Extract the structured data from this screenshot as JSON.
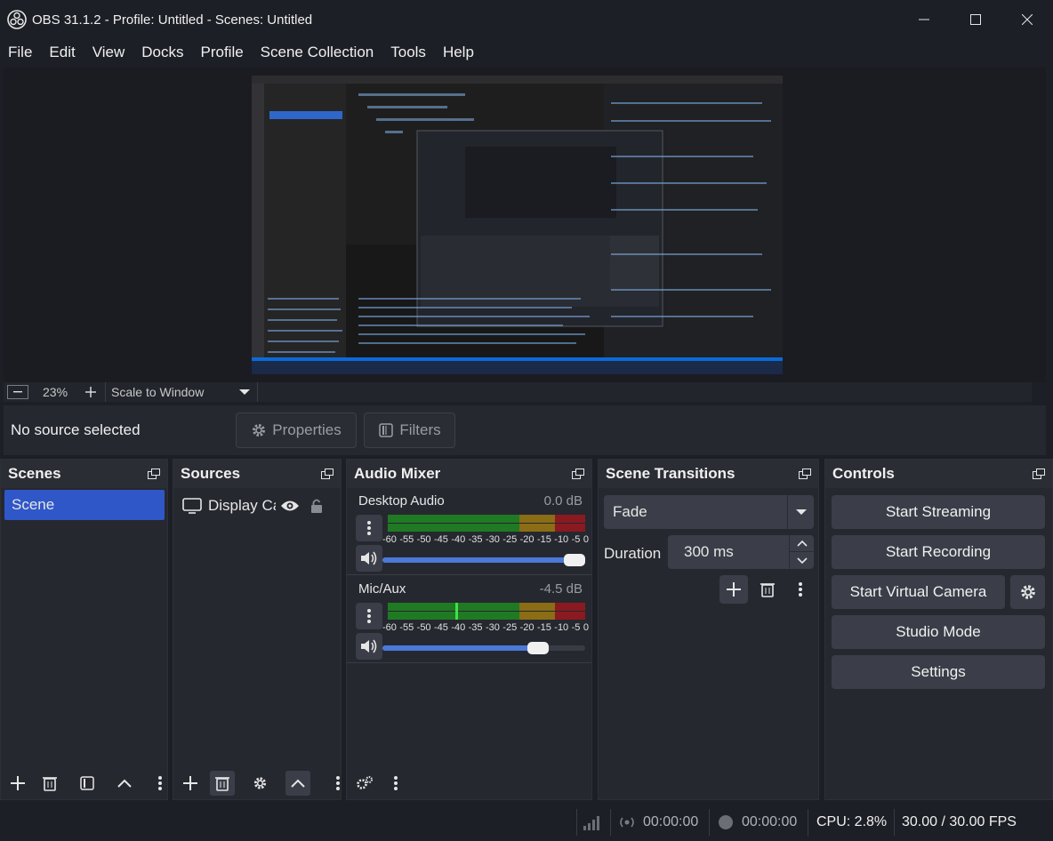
{
  "window": {
    "title": "OBS 31.1.2 - Profile: Untitled - Scenes: Untitled"
  },
  "menu": [
    "File",
    "Edit",
    "View",
    "Docks",
    "Profile",
    "Scene Collection",
    "Tools",
    "Help"
  ],
  "zoom": {
    "value": "23%",
    "scale_mode": "Scale to Window"
  },
  "properties_bar": {
    "no_source": "No source selected",
    "properties": "Properties",
    "filters": "Filters"
  },
  "scenes": {
    "title": "Scenes",
    "items": [
      "Scene"
    ]
  },
  "sources": {
    "title": "Sources",
    "items": [
      "Display Ca"
    ]
  },
  "audio_mixer": {
    "title": "Audio Mixer",
    "channels": [
      {
        "name": "Desktop Audio",
        "db": "0.0 dB",
        "volume_fraction": 1.0
      },
      {
        "name": "Mic/Aux",
        "db": "-4.5 dB",
        "volume_fraction": 0.8
      }
    ],
    "ticks": [
      "-60",
      "-55",
      "-50",
      "-45",
      "-40",
      "-35",
      "-30",
      "-25",
      "-20",
      "-15",
      "-10",
      "-5",
      "0"
    ]
  },
  "transitions": {
    "title": "Scene Transitions",
    "selected": "Fade",
    "duration_label": "Duration",
    "duration_value": "300 ms"
  },
  "controls": {
    "title": "Controls",
    "start_streaming": "Start Streaming",
    "start_recording": "Start Recording",
    "start_virtual_camera": "Start Virtual Camera",
    "studio_mode": "Studio Mode",
    "settings": "Settings"
  },
  "status": {
    "stream_time": "00:00:00",
    "record_time": "00:00:00",
    "cpu": "CPU: 2.8%",
    "fps": "30.00 / 30.00 FPS"
  },
  "colors": {
    "accent": "#2f57c8",
    "meter_green": "#1f7a23",
    "meter_yellow": "#8a6d14",
    "meter_red": "#8a1a20"
  }
}
